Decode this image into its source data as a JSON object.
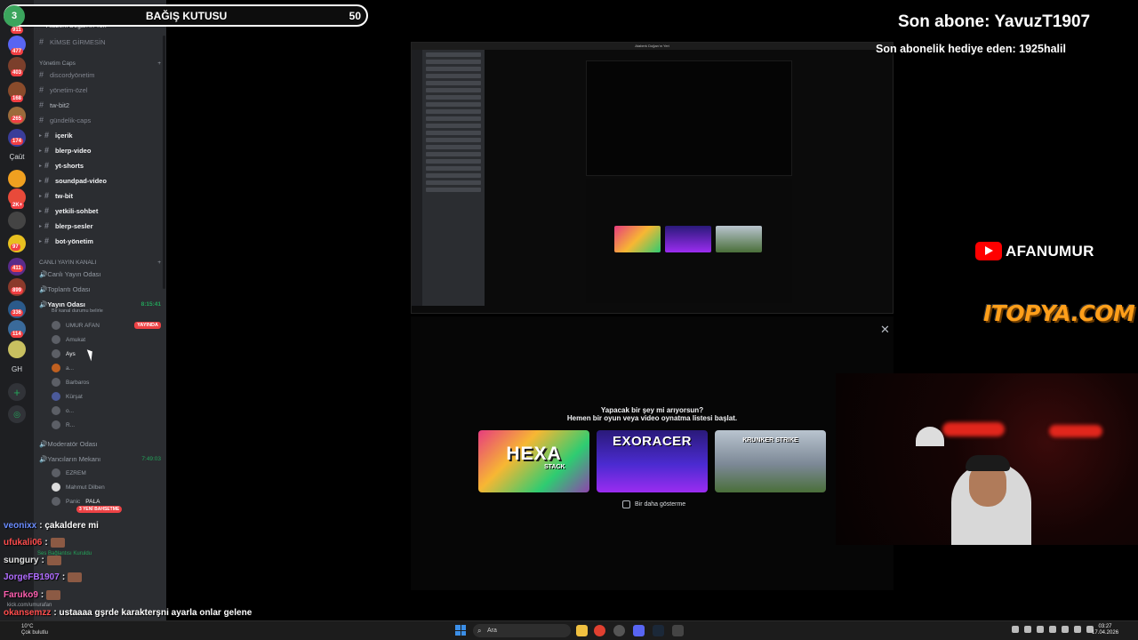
{
  "window": {
    "title": "Ataberk Doğan'ın Yeri"
  },
  "donation": {
    "count": "3",
    "title": "BAĞIŞ KUTUSU",
    "goal": "50"
  },
  "overlay": {
    "last_sub": "Son abone: YavuzT1907",
    "last_gift": "Son abonelik hediye eden: 1925halil",
    "youtube_name": "AFANUMUR",
    "sponsor": "ITOPYA.COM"
  },
  "rail": {
    "badges": [
      "911",
      "477",
      "403",
      "168",
      "265",
      "174",
      "2K+",
      "97",
      "411",
      "899",
      "336",
      "114"
    ],
    "label_cavit": "Çaüt",
    "label_gh": "GH"
  },
  "sidebar": {
    "server_name": "Ataberk Doğan'ın Yeri",
    "channels_top": [
      {
        "name": "KİMSE GİRMESİN",
        "bright": false
      },
      {
        "name": "discordyönetim",
        "bright": false
      },
      {
        "name": "yönetim-özel",
        "bright": false
      },
      {
        "name": "tw-bit2",
        "bright": false
      },
      {
        "name": "gündelik-caps",
        "bright": false
      },
      {
        "name": "içerik",
        "bright": true
      },
      {
        "name": "blerp-video",
        "bright": true
      },
      {
        "name": "yt-shorts",
        "bright": true
      },
      {
        "name": "soundpad-video",
        "bright": true
      },
      {
        "name": "tw-bit",
        "bright": true
      },
      {
        "name": "yetkili-sohbet",
        "bright": true
      },
      {
        "name": "blerp-sesler",
        "bright": true
      },
      {
        "name": "bot-yönetim",
        "bright": true
      }
    ],
    "category_caps": "Yönetim Caps",
    "category_live": "CANLI YAYIN KANALI",
    "voice_live": "Canlı Yayın Odası",
    "voice_meet": "Toplantı Odası",
    "voice_stream": "Yayın Odası",
    "voice_stream_timer": "8:15:41",
    "voice_stream_status": "Bir kanal durumu belirle",
    "users": [
      "UMUR AFAN",
      "Amukat",
      "Ays",
      "a...",
      "Barbaros",
      "Kürşat",
      "o...",
      "R..."
    ],
    "live_label": "YAYINDA",
    "voice_mod": "Moderatör Odası",
    "voice_yanci": "Yancıların Mekanı",
    "voice_yanci_timer": "7:49:03",
    "users2": [
      "EZREM",
      "Mahmut Dilben",
      "Panic",
      "PALA"
    ],
    "voice_connected": "Ses Bağlantısı Kuruldu"
  },
  "activity": {
    "question": "Yapacak bir şey mi arıyorsun?",
    "subtitle": "Hemen bir oyun veya video oynatma listesi başlat.",
    "games": [
      {
        "title": "HEXA",
        "sub": "STACK"
      },
      {
        "title": "EXORACER",
        "sub": ""
      },
      {
        "title": "KRUNKER STRIKE",
        "sub": ""
      }
    ],
    "checkbox_label": "Bir daha gösterme"
  },
  "chat": {
    "badge": "3 YENİ BAHSETME",
    "messages": [
      {
        "user": "veonixx",
        "text": ": çakaldere mi",
        "color": "#6a8cff"
      },
      {
        "user": "ufukali06",
        "text": ":",
        "color": "#ff4d4d"
      },
      {
        "user": "sungury",
        "text": ":",
        "color": "#e0e0e0"
      },
      {
        "user": "JorgeFB1907",
        "text": ":",
        "color": "#b06cff"
      },
      {
        "user": "Faruko9",
        "text": ":",
        "color": "#ff5fb0"
      },
      {
        "user": "okansemzz",
        "text": ": ustaaaa gşrde karakterşni ayarla onlar gelene",
        "color": "#ff4d4d"
      }
    ],
    "kick_link": "kick.com/umurafan"
  },
  "taskbar": {
    "temp": "10°C",
    "weather": "Çok bulutlu",
    "search": "Ara",
    "time": "03:27",
    "date": "17.04.2026"
  }
}
